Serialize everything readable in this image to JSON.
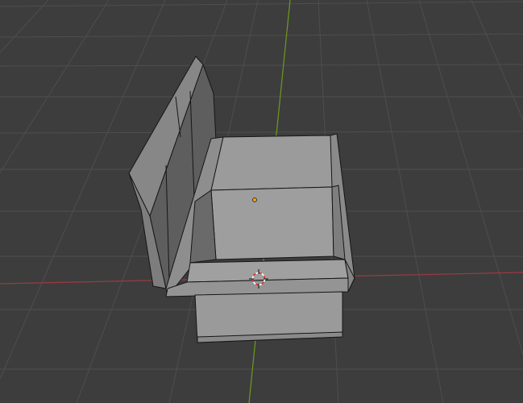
{
  "viewport": {
    "mode": "3D Viewport",
    "background_color": "#3d3d3d",
    "grid_line_color": "#4e4e4e",
    "x_axis_color": "#9c3a44",
    "y_axis_color": "#6e9a1f",
    "mesh_face_color": "#9b9b9b",
    "mesh_edge_color": "#161616",
    "object_origin_color": "#ff9a1a",
    "cursor_colors": [
      "#e03030",
      "#ffffff"
    ]
  },
  "scene": {
    "object": "bench",
    "origin_marker": "object-origin-dot",
    "cursor": "3d-cursor-icon"
  }
}
